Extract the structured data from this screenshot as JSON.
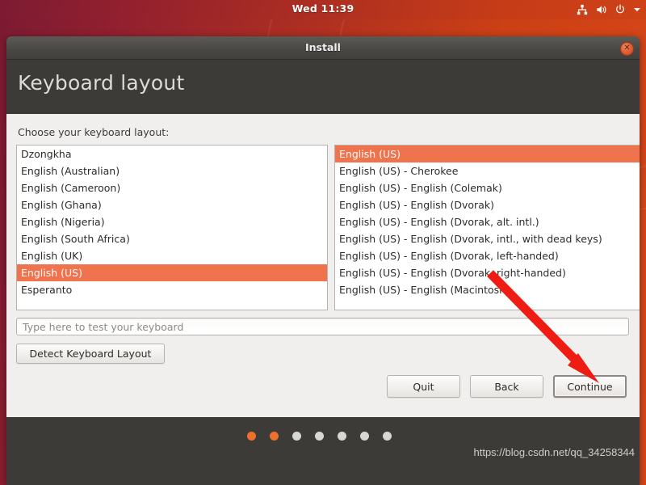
{
  "desktop": {
    "top_panel": {
      "clock": "Wed 11:39",
      "tray_icons": [
        "network-icon",
        "volume-icon",
        "power-icon",
        "chevron-down-icon"
      ]
    }
  },
  "window": {
    "titlebar": {
      "title": "Install",
      "close_label": "✕"
    },
    "page_title": "Keyboard layout",
    "choose_label": "Choose your keyboard layout:",
    "layout_list": {
      "selected_index": 7,
      "items": [
        "Dzongkha",
        "English (Australian)",
        "English (Cameroon)",
        "English (Ghana)",
        "English (Nigeria)",
        "English (South Africa)",
        "English (UK)",
        "English (US)",
        "Esperanto"
      ]
    },
    "variant_list": {
      "selected_index": 0,
      "items": [
        "English (US)",
        "English (US) - Cherokee",
        "English (US) - English (Colemak)",
        "English (US) - English (Dvorak)",
        "English (US) - English (Dvorak, alt. intl.)",
        "English (US) - English (Dvorak, intl., with dead keys)",
        "English (US) - English (Dvorak, left-handed)",
        "English (US) - English (Dvorak, right-handed)",
        "English (US) - English (Macintosh)"
      ]
    },
    "test_field": {
      "placeholder": "Type here to test your keyboard",
      "value": ""
    },
    "detect_button": "Detect Keyboard Layout",
    "actions": {
      "quit": "Quit",
      "back": "Back",
      "continue": "Continue"
    },
    "footer": {
      "dots_total": 7,
      "dots_active": 2,
      "watermark": "https://blog.csdn.net/qq_34258344"
    }
  },
  "annotation": {
    "arrow_color": "#ee1c12",
    "points_to": "continue-button"
  },
  "colors": {
    "accent_orange": "#ef734d",
    "dot_active": "#ef6f2c",
    "header_dark": "#3c3b37",
    "content_bg": "#f1efed"
  }
}
